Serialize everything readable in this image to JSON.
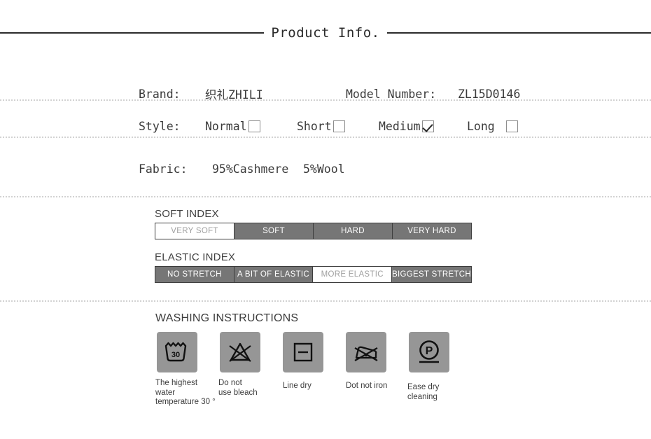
{
  "header": {
    "title": "Product Info."
  },
  "specs": {
    "brand_label": "Brand:",
    "brand_value": "织礼ZHILI",
    "model_label": "Model Number:",
    "model_value": "ZL15D0146",
    "style_label": "Style:",
    "style_options": [
      {
        "label": "Normal",
        "checked": false
      },
      {
        "label": "Short",
        "checked": false
      },
      {
        "label": "Medium",
        "checked": true
      },
      {
        "label": "Long",
        "checked": false
      }
    ],
    "fabric_label": "Fabric:",
    "fabric_value_1": "95%Cashmere",
    "fabric_value_2": "5%Wool"
  },
  "soft_index": {
    "title": "SOFT INDEX",
    "segments": [
      {
        "label": "VERY SOFT",
        "active": true
      },
      {
        "label": "SOFT",
        "active": false
      },
      {
        "label": "HARD",
        "active": false
      },
      {
        "label": "VERY HARD",
        "active": false
      }
    ]
  },
  "elastic_index": {
    "title": "ELASTIC INDEX",
    "segments": [
      {
        "label": "NO STRETCH",
        "active": false
      },
      {
        "label": "A BIT OF ELASTIC",
        "active": false
      },
      {
        "label": "MORE ELASTIC",
        "active": true
      },
      {
        "label": "BIGGEST STRETCH",
        "active": false
      }
    ]
  },
  "washing": {
    "title": "WASHING INSTRUCTIONS",
    "items": [
      {
        "icon": "wash-tub-30-icon",
        "label_line1": "The highest water",
        "label_line2": "temperature 30 °",
        "temperature": "30"
      },
      {
        "icon": "do-not-bleach-icon",
        "label_line1": "Do not",
        "label_line2": "use bleach"
      },
      {
        "icon": "line-dry-icon",
        "label_line1": "Line dry",
        "label_line2": ""
      },
      {
        "icon": "do-not-iron-icon",
        "label_line1": "Dot not iron",
        "label_line2": ""
      },
      {
        "icon": "gentle-dry-clean-p-icon",
        "label_line1": "Ease dry cleaning",
        "label_line2": "",
        "symbol": "P"
      }
    ]
  },
  "colors": {
    "ink": "#2b2b2b",
    "segment_gray": "#767676",
    "icon_tile_gray": "#969696",
    "separator_gray": "#d2d2d2"
  }
}
